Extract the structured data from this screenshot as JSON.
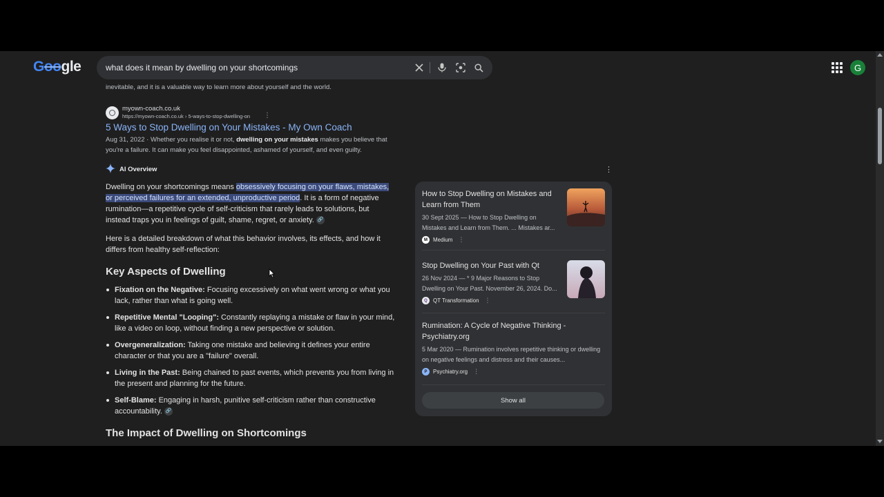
{
  "header": {
    "search_query": "what does it mean by dwelling on your shortcomings",
    "avatar_letter": "G"
  },
  "results": {
    "cut_text": "inevitable, and it is a valuable way to learn more about yourself and the world.",
    "result": {
      "site_name": "myown-coach.co.uk",
      "url": "https://myown-coach.co.uk › 5-ways-to-stop-dwelling-on",
      "title": "5 Ways to Stop Dwelling on Your Mistakes - My Own Coach",
      "date": "Aug 31, 2022",
      "snippet_pre": " · Whether you realise it or not, ",
      "snippet_bold": "dwelling on your mistakes",
      "snippet_post": " makes you believe that you're a failure. It can make you feel disappointed, ashamed of yourself, and even guilty."
    }
  },
  "ai_overview": {
    "label": "AI Overview",
    "p1_pre": "Dwelling on your shortcomings means ",
    "p1_highlight": "obsessively focusing on your flaws, mistakes, or perceived failures for an extended, unproductive period",
    "p1_post": ". It is a form of negative rumination—a repetitive cycle of self-criticism that rarely leads to solutions, but instead traps you in feelings of guilt, shame, regret, or anxiety.",
    "p2": "Here is a detailed breakdown of what this behavior involves, its effects, and how it differs from healthy self-reflection:",
    "heading_key": "Key Aspects of Dwelling",
    "bullets": [
      {
        "term": "Fixation on the Negative:",
        "text": " Focusing excessively on what went wrong or what you lack, rather than what is going well."
      },
      {
        "term": "Repetitive Mental \"Looping\":",
        "text": " Constantly replaying a mistake or flaw in your mind, like a video on loop, without finding a new perspective or solution."
      },
      {
        "term": "Overgeneralization:",
        "text": " Taking one mistake and believing it defines your entire character or that you are a \"failure\" overall."
      },
      {
        "term": "Living in the Past:",
        "text": " Being chained to past events, which prevents you from living in the present and planning for the future."
      },
      {
        "term": "Self-Blame:",
        "text": " Engaging in harsh, punitive self-criticism rather than constructive accountability."
      }
    ],
    "heading_impact": "The Impact of Dwelling on Shortcomings"
  },
  "sources": [
    {
      "title": "How to Stop Dwelling on Mistakes and Learn from Them",
      "snippet": "30 Sept 2025 — How to Stop Dwelling on Mistakes and Learn from Them. ... Mistakes ar...",
      "source": "Medium",
      "icon_text": "M"
    },
    {
      "title": "Stop Dwelling on Your Past with Qt",
      "snippet": "26 Nov 2024 — * 9 Major Reasons to Stop Dwelling on Your Past. November 26, 2024. Do...",
      "source": "QT Transformation",
      "icon_text": "Q"
    },
    {
      "title": "Rumination: A Cycle of Negative Thinking - Psychiatry.org",
      "snippet": "5 Mar 2020 — Rumination involves repetitive thinking or dwelling on negative feelings and distress and their causes...",
      "source": "Psychiatry.org",
      "icon_text": "P"
    }
  ],
  "show_all_label": "Show all",
  "colors": {
    "background": "#1f1f1f",
    "link": "#8ab4f8",
    "highlight": "#3b4a7a",
    "panel": "#303134"
  }
}
